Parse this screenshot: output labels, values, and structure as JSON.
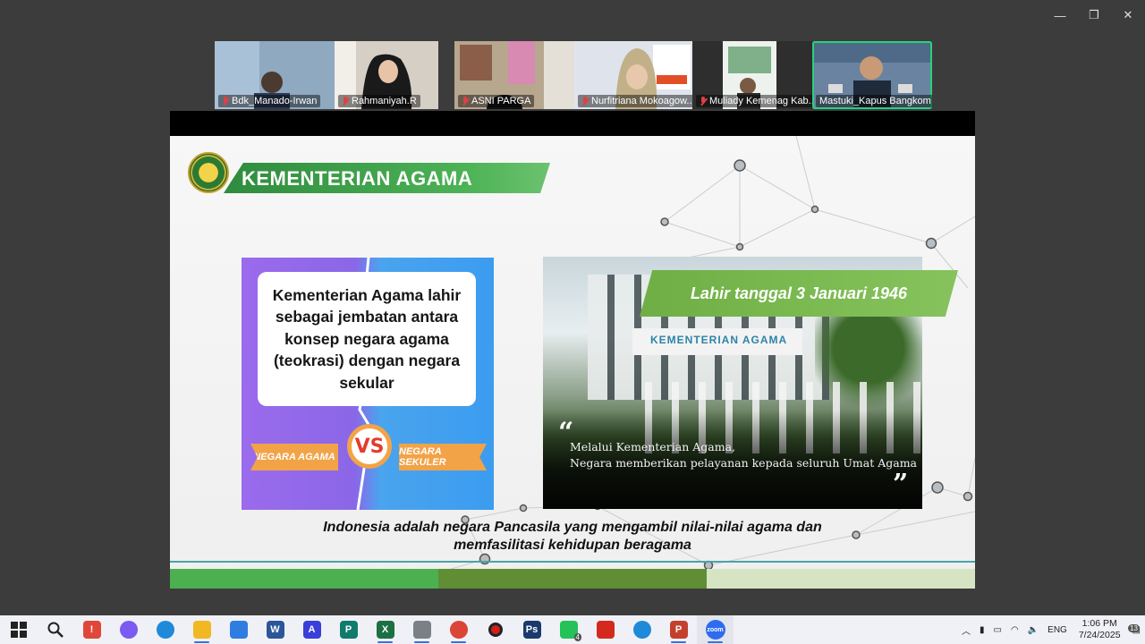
{
  "window": {
    "controls": [
      "—",
      "❐",
      "✕"
    ]
  },
  "participants": [
    {
      "name": "Bdk_Manado-Irwan",
      "muted": true,
      "bg": "#9ab2c8"
    },
    {
      "name": "Rahmaniyah.R",
      "muted": true,
      "bg": "#cfc7bf"
    },
    {
      "name": "ASNI PARGA",
      "muted": true,
      "bg": "#b8a890"
    },
    {
      "name": "Nurfitriana Mokoagow...",
      "muted": true,
      "bg": "#d8dde6"
    },
    {
      "name": "Muliady Kemenag Kab....",
      "muted": true,
      "bg": "#3c3c3c"
    },
    {
      "name": "Mastuki_Kapus Bangkom",
      "muted": false,
      "bg": "#6e8aa6"
    }
  ],
  "slide": {
    "banner_title": "KEMENTERIAN AGAMA",
    "bubble_text": "Kementerian Agama lahir sebagai jembatan antara konsep negara agama (teokrasi) dengan negara sekular",
    "ribbon_left": "NEGARA AGAMA",
    "vs": "VS",
    "ribbon_right": "NEGARA SEKULER",
    "photo_sign": "KEMENTERIAN AGAMA",
    "date_tag": "Lahir tanggal 3 Januari 1946",
    "quote_open": "“",
    "quote_line1": "Melalui Kementerian Agama,",
    "quote_line2": "Negara memberikan pelayanan kepada seluruh Umat Agama",
    "quote_close": "”",
    "caption_line1": "Indonesia adalah negara Pancasila yang mengambil nilai-nilai agama dan",
    "caption_line2": "memfasilitasi kehidupan beragama",
    "bar_colors": [
      "#4caf50",
      "#5f8e35",
      "#d6e4c4"
    ]
  },
  "taskbar": {
    "apps": [
      {
        "name": "windows-start",
        "glyph": "",
        "color": "#1e6fd8"
      },
      {
        "name": "search",
        "glyph": "",
        "color": "#222"
      },
      {
        "name": "app-red",
        "glyph": "!",
        "color": "#e0473a"
      },
      {
        "name": "copilot",
        "glyph": "",
        "color": "#7a5af0"
      },
      {
        "name": "edge",
        "glyph": "",
        "color": "#1f8ad8"
      },
      {
        "name": "file-explorer",
        "glyph": "",
        "color": "#f2b824"
      },
      {
        "name": "mail",
        "glyph": "",
        "color": "#2f7de1"
      },
      {
        "name": "word",
        "glyph": "W",
        "color": "#2b579a"
      },
      {
        "name": "app-blue",
        "glyph": "A",
        "color": "#3a3fd8"
      },
      {
        "name": "publisher",
        "glyph": "P",
        "color": "#0f7b6c"
      },
      {
        "name": "excel",
        "glyph": "X",
        "color": "#1d7044"
      },
      {
        "name": "app-gray",
        "glyph": "",
        "color": "#7a8088"
      },
      {
        "name": "chrome",
        "glyph": "",
        "color": "#db4437"
      },
      {
        "name": "record",
        "glyph": "",
        "color": "#d0201b"
      },
      {
        "name": "photoshop",
        "glyph": "Ps",
        "color": "#1a3a6e"
      },
      {
        "name": "whatsapp",
        "glyph": "",
        "color": "#25c25a",
        "badge": "4"
      },
      {
        "name": "acrobat",
        "glyph": "",
        "color": "#d42a1e"
      },
      {
        "name": "edge-alt",
        "glyph": "",
        "color": "#1f8ad8"
      },
      {
        "name": "powerpoint",
        "glyph": "P",
        "color": "#c4402c"
      },
      {
        "name": "zoom",
        "glyph": "zoom",
        "color": "#2d6cf0"
      }
    ],
    "tray_lang": "ENG",
    "time": "1:06 PM",
    "date": "7/24/2025",
    "notif_count": "13"
  }
}
